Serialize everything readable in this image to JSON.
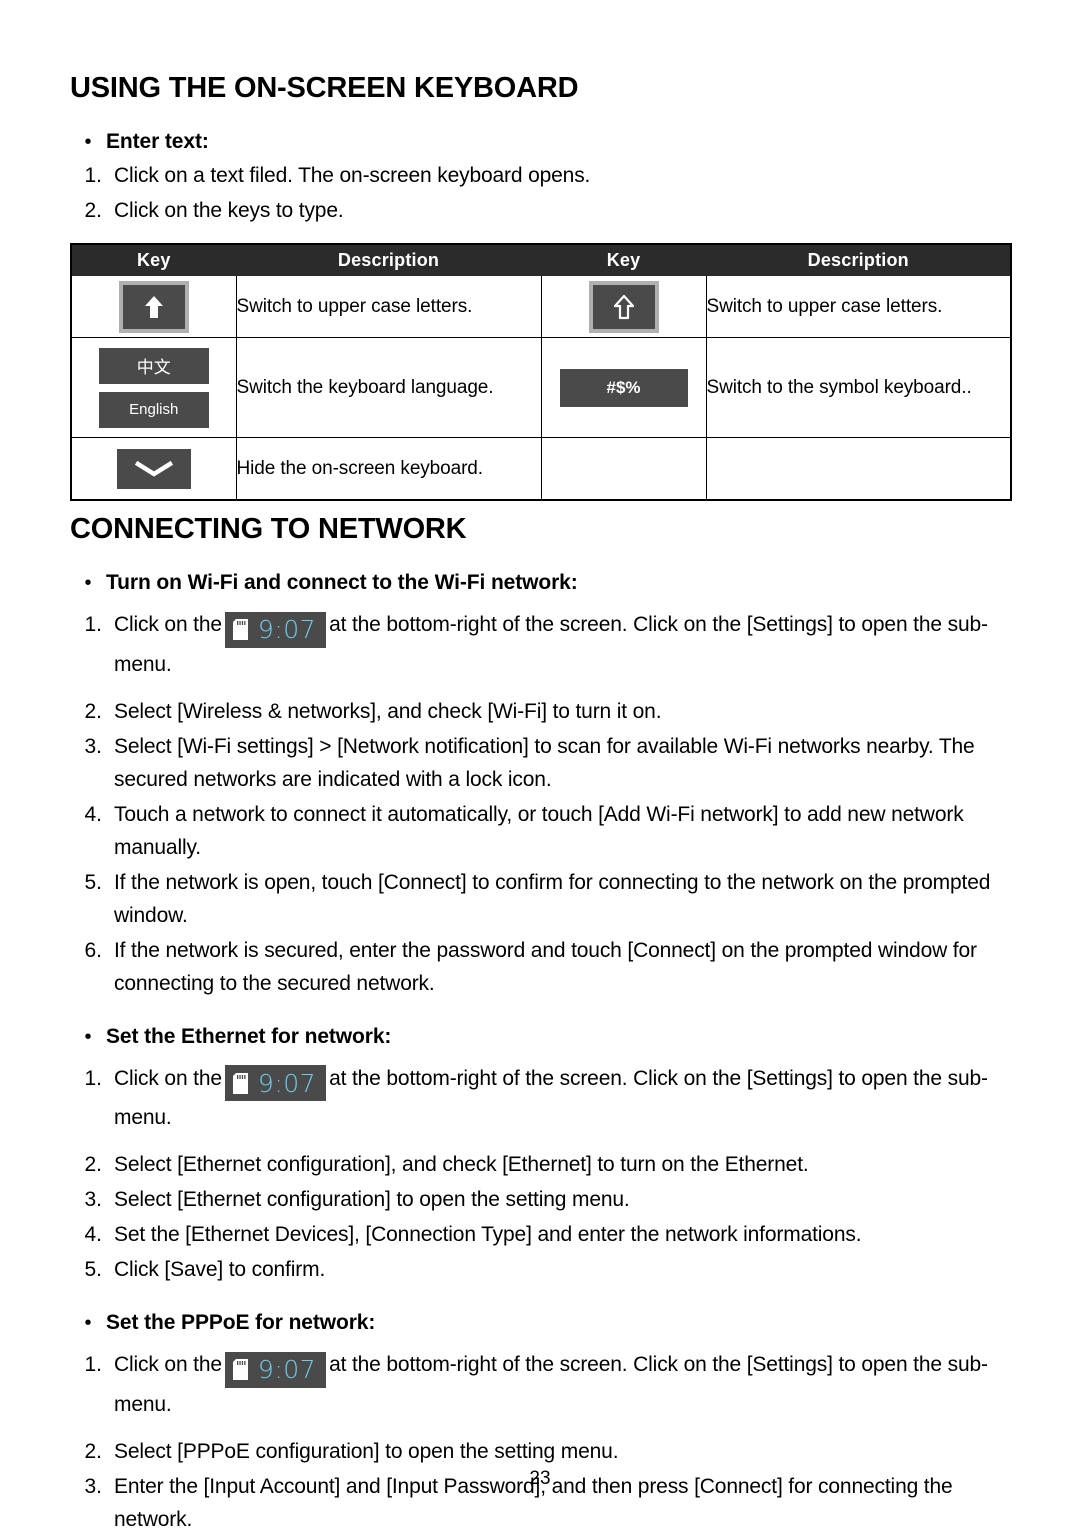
{
  "document": {
    "page_number": "23"
  },
  "sections": {
    "keyboard": {
      "title": "USING THE ON-SCREEN KEYBOARD",
      "bullet": "Enter text:",
      "steps": [
        {
          "num": "1.",
          "text": "Click on a text filed. The on-screen keyboard opens."
        },
        {
          "num": "2.",
          "text": "Click on the keys to type."
        }
      ],
      "table": {
        "headers": [
          "Key",
          "Description",
          "Key",
          "Description"
        ],
        "rows": [
          {
            "left_key_icon": "shift-arrow-filled-key",
            "left_desc": "Switch to upper case letters.",
            "right_key_icon": "shift-arrow-outline-key",
            "right_desc": "Switch to upper case letters."
          },
          {
            "left_key_icon": "language-switch-key",
            "left_key_labels": [
              "中文",
              "English"
            ],
            "left_desc": "Switch the keyboard language.",
            "right_key_icon": "symbol-keyboard-key",
            "right_key_label": "#$%",
            "right_desc": "Switch to the symbol keyboard.."
          },
          {
            "left_key_icon": "hide-keyboard-chevron-key",
            "left_desc": "Hide the on-screen keyboard.",
            "right_key_icon": "",
            "right_desc": ""
          }
        ]
      }
    },
    "network": {
      "title": "CONNECTING TO NETWORK",
      "groups": [
        {
          "bullet": "Turn on Wi-Fi and connect to the Wi-Fi network:",
          "steps": [
            {
              "num": "1.",
              "before": "Click on the",
              "clock": {
                "time": "9:07",
                "icon": "sd-card-icon"
              },
              "after": "at the bottom-right of the screen. Click on the [Settings] to open the sub-menu."
            },
            {
              "num": "2.",
              "text": "Select [Wireless & networks], and check [Wi-Fi] to turn it on."
            },
            {
              "num": "3.",
              "text": "Select [Wi-Fi settings] > [Network notification] to scan for available Wi-Fi networks nearby. The secured networks are indicated with a lock icon."
            },
            {
              "num": "4.",
              "text": "Touch a network to connect it automatically, or touch [Add Wi-Fi network] to add new network manually."
            },
            {
              "num": "5.",
              "text": "If the network is open, touch [Connect] to confirm for connecting to the network on the prompted window."
            },
            {
              "num": "6.",
              "text": "If the network is secured, enter the password and touch [Connect] on the prompted window for connecting to the secured network."
            }
          ]
        },
        {
          "bullet": "Set the Ethernet for network:",
          "steps": [
            {
              "num": "1.",
              "before": "Click on the",
              "clock": {
                "time": "9:07",
                "icon": "sd-card-icon"
              },
              "after": "at the bottom-right of the screen. Click on the [Settings] to open the sub-menu."
            },
            {
              "num": "2.",
              "text": "Select [Ethernet configuration], and check [Ethernet] to turn on the Ethernet."
            },
            {
              "num": "3.",
              "text": "Select [Ethernet configuration] to open the setting menu."
            },
            {
              "num": "4.",
              "text": "Set the [Ethernet Devices], [Connection Type] and enter the network informations."
            },
            {
              "num": "5.",
              "text": "Click [Save] to confirm."
            }
          ]
        },
        {
          "bullet": "Set the PPPoE for network:",
          "steps": [
            {
              "num": "1.",
              "before": "Click on the",
              "clock": {
                "time": "9:07",
                "icon": "sd-card-icon"
              },
              "after": "at the bottom-right of the screen. Click on the [Settings] to open the sub-menu."
            },
            {
              "num": "2.",
              "text": "Select [PPPoE configuration] to open the setting menu."
            },
            {
              "num": "3.",
              "text": "Enter the [Input Account] and [Input Password], and then press [Connect] for connecting the network."
            }
          ]
        }
      ]
    }
  },
  "colors": {
    "table_header_bg": "#2b2b2b",
    "key_face": "#4a4a4a",
    "key_bezel": "#b0b0b0",
    "clock_digits": "#6ecbe8"
  }
}
